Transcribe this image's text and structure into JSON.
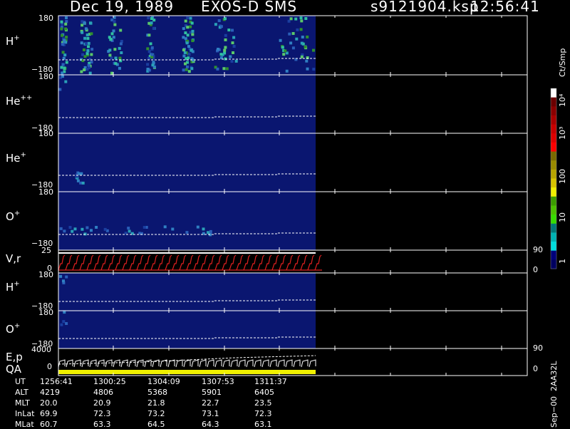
{
  "header": {
    "date": "Dec 19, 1989",
    "mission": "EXOS-D SMS",
    "file": "s9121904.ksp",
    "time": "12:56:41"
  },
  "colorbar": {
    "unit_label": "Ct/Smp",
    "labels": [
      "10⁴",
      "10³",
      "100",
      "10",
      "1"
    ],
    "colors": [
      "#ffffff",
      "#6b0000",
      "#8a0000",
      "#a80000",
      "#c80000",
      "#e00000",
      "#ff0000",
      "#7a6a00",
      "#9a8a00",
      "#b8a400",
      "#d8c400",
      "#f0f000",
      "#3c9c00",
      "#4cc000",
      "#38dc00",
      "#007878",
      "#00b4b4",
      "#00dede",
      "#00007a",
      "#000060"
    ]
  },
  "panels": [
    {
      "label": "H",
      "charge": "+",
      "ytop": "180",
      "ybot": "−180"
    },
    {
      "label": "He",
      "charge": "++",
      "ytop": "180",
      "ybot": "−180"
    },
    {
      "label": "He",
      "charge": "+",
      "ytop": "180",
      "ybot": "−180"
    },
    {
      "label": "O",
      "charge": "+",
      "ytop": "180",
      "ybot": "−180"
    },
    {
      "label": "V,r",
      "charge": "",
      "ytop": "25",
      "ybot": "0",
      "right_top": "90",
      "right_bot": "0"
    },
    {
      "label": "H",
      "charge": "+",
      "ytop": "180",
      "ybot": "−180"
    },
    {
      "label": "O",
      "charge": "+",
      "ytop": "180",
      "ybot": "−180"
    },
    {
      "label": "E,p",
      "label2": "QA",
      "charge": "",
      "ytop": "4000",
      "ybot": "0",
      "right_top": "90",
      "right_bot": "0"
    }
  ],
  "ut_table": {
    "rows": [
      {
        "name": "UT",
        "values": [
          "1256:41",
          "1300:25",
          "1304:09",
          "1307:53",
          "1311:37"
        ]
      },
      {
        "name": "ALT",
        "values": [
          "4219",
          "4806",
          "5368",
          "5901",
          "6405"
        ]
      },
      {
        "name": "MLT",
        "values": [
          "20.0",
          "20.9",
          "21.8",
          "22.7",
          "23.5"
        ]
      },
      {
        "name": "InLat",
        "values": [
          "69.9",
          "72.3",
          "73.2",
          "73.1",
          "72.3"
        ]
      },
      {
        "name": "MLat",
        "values": [
          "60.7",
          "63.3",
          "64.5",
          "64.3",
          "63.1"
        ]
      }
    ]
  },
  "footer_vertical": "Sep−00  2AA32L",
  "chart_data": {
    "type": "heatmap",
    "title": "Dec 19, 1989   EXOS-D SMS",
    "x_ticks": [
      "1256:41",
      "1300:25",
      "1304:09",
      "1307:53",
      "1311:37"
    ],
    "series": [
      {
        "name": "H+",
        "ylim": [
          -180,
          180
        ]
      },
      {
        "name": "He++",
        "ylim": [
          -180,
          180
        ]
      },
      {
        "name": "He+",
        "ylim": [
          -180,
          180
        ]
      },
      {
        "name": "O+",
        "ylim": [
          -180,
          180
        ]
      },
      {
        "name": "V,r",
        "ylim": [
          0,
          25
        ]
      },
      {
        "name": "H+",
        "ylim": [
          -180,
          180
        ]
      },
      {
        "name": "O+",
        "ylim": [
          -180,
          180
        ]
      },
      {
        "name": "E,p",
        "ylim": [
          0,
          4000
        ]
      }
    ],
    "colorbar_unit": "Ct/Smp",
    "colorbar_range": [
      1,
      10000
    ]
  }
}
